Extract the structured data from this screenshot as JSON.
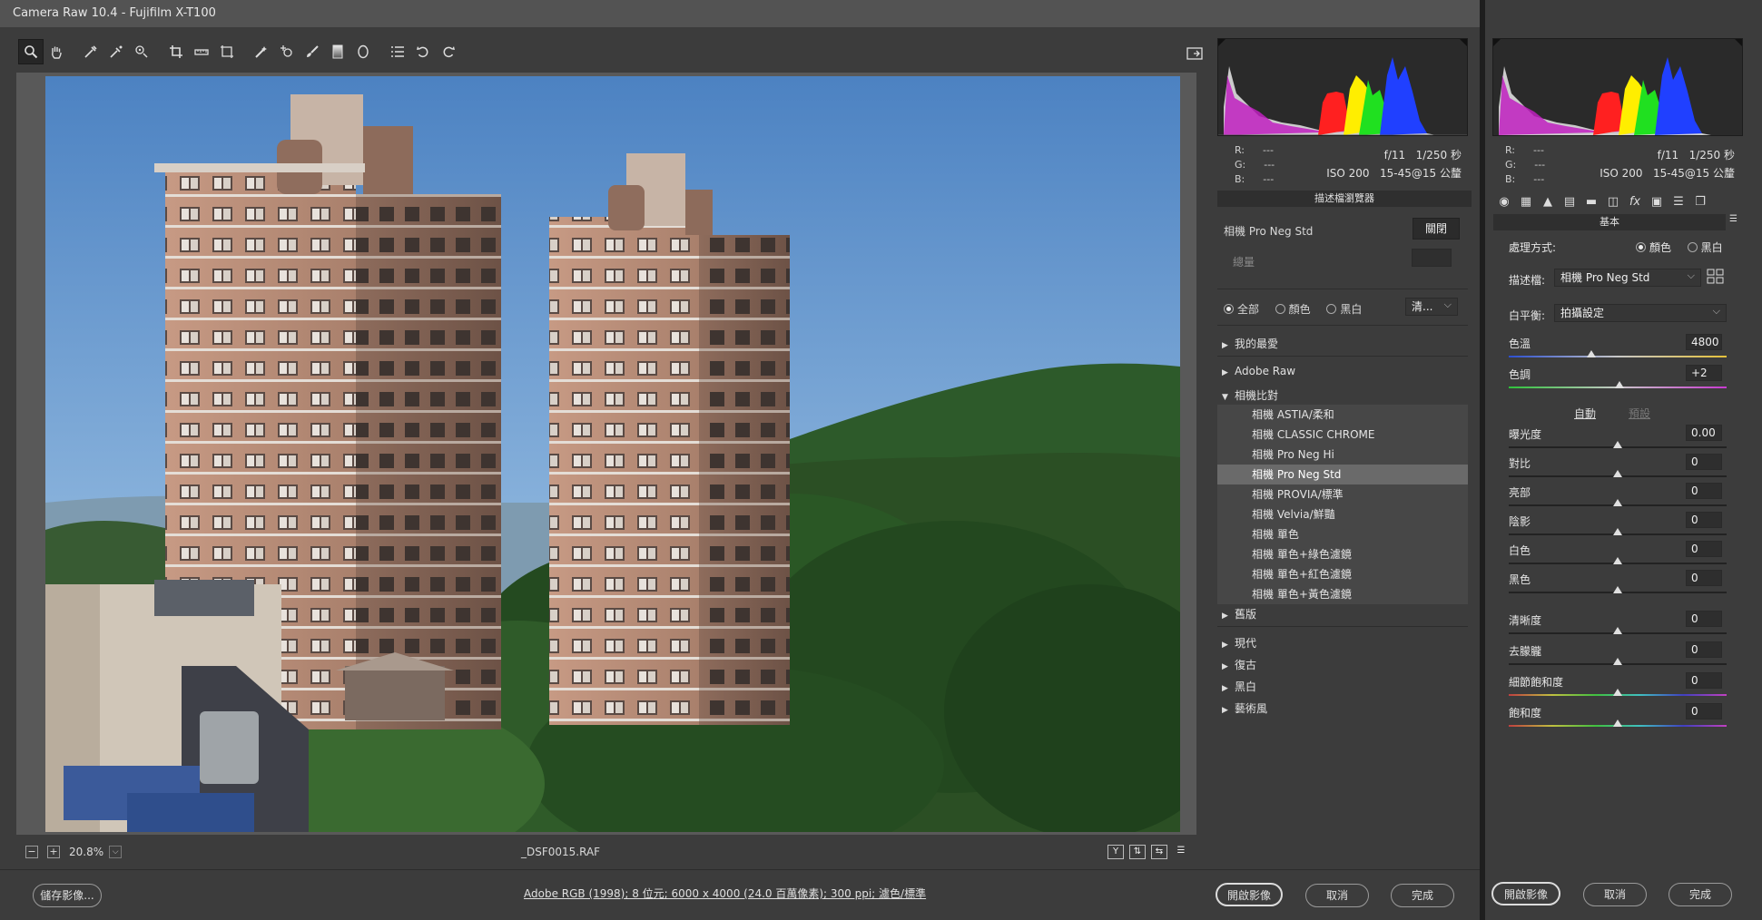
{
  "title": "Camera Raw 10.4  -  Fujifilm X-T100",
  "toolbar": {
    "tools": [
      "zoom-icon",
      "hand-icon",
      "white-balance-icon",
      "color-sampler-icon",
      "target-adjust-icon",
      "crop-icon",
      "straighten-icon",
      "transform-icon",
      "spot-removal-icon",
      "red-eye-icon",
      "adjustment-brush-icon",
      "graduated-filter-icon",
      "radial-filter-icon",
      "preferences-icon",
      "rotate-left-icon",
      "rotate-right-icon"
    ],
    "right_tool": "fullscreen-toggle-icon"
  },
  "status": {
    "zoom_out": "−",
    "zoom_in": "+",
    "zoom": "20.8%",
    "zoom_dd": "⌵",
    "filename": "_DSF0015.RAF",
    "icons": [
      {
        "name": "before-after-y-icon",
        "glyph": "Y"
      },
      {
        "name": "before-after-cycle-icon",
        "glyph": "⇅"
      },
      {
        "name": "before-after-swap-icon",
        "glyph": "⇆"
      },
      {
        "name": "before-after-settings-icon",
        "glyph": "☰"
      }
    ]
  },
  "bottom": {
    "save": "儲存影像...",
    "info": "Adobe RGB (1998); 8 位元; 6000 x 4000 (24.0 百萬像素); 300 ppi; 濾色/標準",
    "open": "開啟影像",
    "cancel": "取消",
    "done": "完成"
  },
  "histogram": {
    "r_label": "R:",
    "g_label": "G:",
    "b_label": "B:",
    "r": "---",
    "g": "---",
    "b": "---",
    "aperture": "f/11",
    "shutter": "1/250 秒",
    "iso": "ISO 200",
    "lens": "15-45@15 公釐"
  },
  "profile_browser": {
    "header": "描述檔瀏覽器",
    "current": "相機 Pro Neg Std",
    "close": "關閉",
    "amount_label": "總量",
    "filter_all": "全部",
    "filter_color": "顏色",
    "filter_bw": "黑白",
    "view_dd": "清...",
    "groups": [
      {
        "label": "我的最愛",
        "open": false
      },
      {
        "label": "Adobe Raw",
        "open": false
      },
      {
        "label": "相機比對",
        "open": true
      }
    ],
    "camera_items": [
      "相機 ASTIA/柔和",
      "相機 CLASSIC CHROME",
      "相機 Pro Neg Hi",
      "相機 Pro Neg Std",
      "相機 PROVIA/標準",
      "相機 Velvia/鮮豔",
      "相機 單色",
      "相機 單色+綠色濾鏡",
      "相機 單色+紅色濾鏡",
      "相機 單色+黃色濾鏡"
    ],
    "selected_index": 3,
    "groups_after": [
      "舊版",
      "現代",
      "復古",
      "黑白",
      "藝術風"
    ]
  },
  "basic": {
    "header": "基本",
    "treatment_label": "處理方式:",
    "treatment_color": "顏色",
    "treatment_bw": "黑白",
    "profile_label": "描述檔:",
    "profile_value": "相機 Pro Neg Std",
    "wb_label": "白平衡:",
    "wb_value": "拍攝設定",
    "auto": "自動",
    "default": "預設",
    "sliders_wb": [
      {
        "label": "色溫",
        "value": "4800",
        "pos": 0.38,
        "kind": "temp"
      },
      {
        "label": "色調",
        "value": "+2",
        "pos": 0.51,
        "kind": "tint"
      }
    ],
    "sliders_tone": [
      {
        "label": "曝光度",
        "value": "0.00",
        "pos": 0.5
      },
      {
        "label": "對比",
        "value": "0",
        "pos": 0.5
      },
      {
        "label": "亮部",
        "value": "0",
        "pos": 0.5
      },
      {
        "label": "陰影",
        "value": "0",
        "pos": 0.5
      },
      {
        "label": "白色",
        "value": "0",
        "pos": 0.5
      },
      {
        "label": "黑色",
        "value": "0",
        "pos": 0.5
      }
    ],
    "sliders_presence": [
      {
        "label": "清晰度",
        "value": "0",
        "pos": 0.5,
        "kind": "plain"
      },
      {
        "label": "去朦朧",
        "value": "0",
        "pos": 0.5,
        "kind": "plain"
      },
      {
        "label": "細節飽和度",
        "value": "0",
        "pos": 0.5,
        "kind": "spectrum"
      },
      {
        "label": "飽和度",
        "value": "0",
        "pos": 0.5,
        "kind": "spectrum"
      }
    ],
    "open": "開啟影像",
    "cancel": "取消",
    "done": "完成"
  },
  "colors": {
    "accent": "#dcdcdc",
    "panel": "#3c3c3c",
    "selected": "#6a6a6a"
  }
}
